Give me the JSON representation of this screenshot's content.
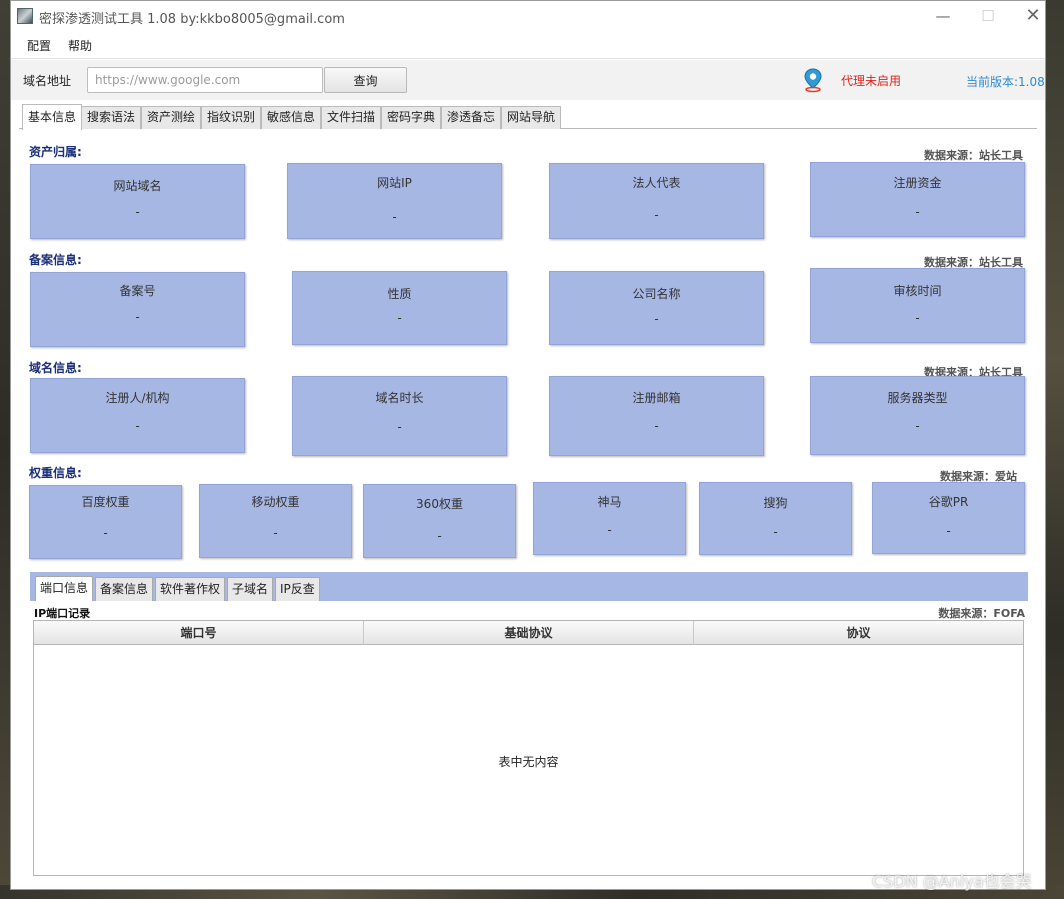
{
  "window": {
    "title": "密探渗透测试工具 1.08 by:kkbo8005@gmail.com",
    "controls": {
      "minimize": "—",
      "maximize": "☐",
      "close": "✕"
    }
  },
  "menu": {
    "items": [
      "配置",
      "帮助"
    ]
  },
  "toolbar": {
    "domain_label": "域名地址",
    "domain_placeholder": "https://www.google.com",
    "query_button": "查询",
    "proxy_status": "代理未启用",
    "version": "当前版本:1.08",
    "proxy_status_color": "#e0241f",
    "version_color": "#2c8ad6"
  },
  "main_tabs": [
    "基本信息",
    "搜索语法",
    "资产测绘",
    "指纹识别",
    "敏感信息",
    "文件扫描",
    "密码字典",
    "渗透备忘",
    "网站导航"
  ],
  "sections": {
    "assets": {
      "title": "资产归属:",
      "source": "数据来源：站长工具",
      "cards": [
        {
          "label": "网站域名",
          "value": "-"
        },
        {
          "label": "网站IP",
          "value": "-"
        },
        {
          "label": "法人代表",
          "value": "-"
        },
        {
          "label": "注册资金",
          "value": "-"
        }
      ]
    },
    "icp": {
      "title": "备案信息:",
      "source": "数据来源：站长工具",
      "cards": [
        {
          "label": "备案号",
          "value": "-"
        },
        {
          "label": "性质",
          "value": "-"
        },
        {
          "label": "公司名称",
          "value": "-"
        },
        {
          "label": "审核时间",
          "value": "-"
        }
      ]
    },
    "domain": {
      "title": "域名信息:",
      "source": "数据来源：站长工具",
      "cards": [
        {
          "label": "注册人/机构",
          "value": "-"
        },
        {
          "label": "域名时长",
          "value": "-"
        },
        {
          "label": "注册邮箱",
          "value": "-"
        },
        {
          "label": "服务器类型",
          "value": "-"
        }
      ]
    },
    "weight": {
      "title": "权重信息:",
      "source": "数据来源：爱站",
      "cards": [
        {
          "label": "百度权重",
          "value": "-"
        },
        {
          "label": "移动权重",
          "value": "-"
        },
        {
          "label": "360权重",
          "value": "-"
        },
        {
          "label": "神马",
          "value": "-"
        },
        {
          "label": "搜狗",
          "value": "-"
        },
        {
          "label": "谷歌PR",
          "value": "-"
        }
      ]
    }
  },
  "sub_tabs": [
    "端口信息",
    "备案信息",
    "软件著作权",
    "子域名",
    "IP反查"
  ],
  "port_table": {
    "title": "IP端口记录",
    "source": "数据来源：FOFA",
    "columns": [
      "端口号",
      "基础协议",
      "协议"
    ],
    "empty_text": "表中无内容"
  },
  "watermark": "CSDN @Aniya也会哭",
  "colors": {
    "card_bg": "#a7b7e4",
    "section_title": "#1c2f7a"
  }
}
